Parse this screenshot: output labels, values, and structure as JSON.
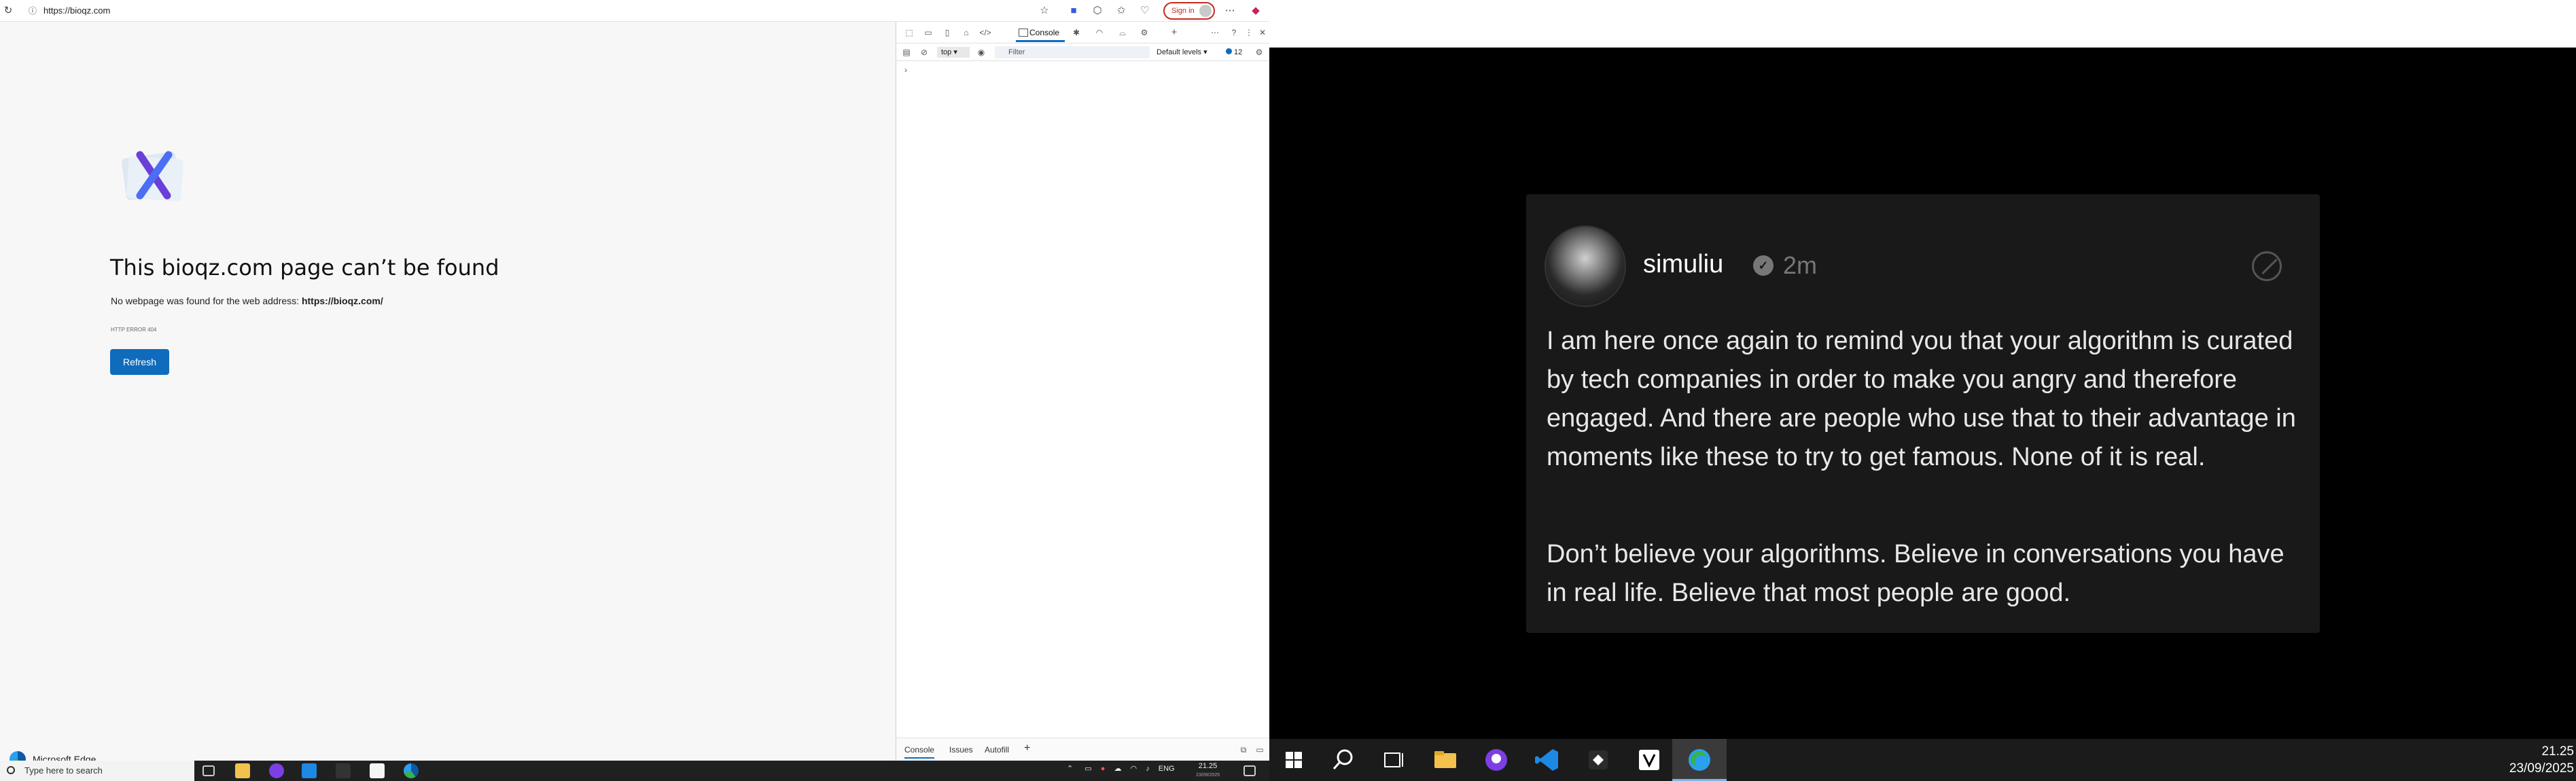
{
  "left_browser": {
    "url": "https://bioqz.com",
    "sign_in_label": "Sign in",
    "error": {
      "title": "This bioqz.com page can’t be found",
      "description": "No webpage was found for the web address:",
      "address": "https://bioqz.com/",
      "code": "HTTP ERROR 404",
      "refresh_label": "Refresh"
    },
    "brand": "Microsoft Edge"
  },
  "devtools": {
    "active_tab": "Console",
    "context": "top",
    "filter_placeholder": "Filter",
    "levels": "Default levels",
    "message_count": "12",
    "prompt": "›",
    "drawer_tabs": [
      "Console",
      "Issues",
      "Autofill"
    ],
    "add_tab": "+"
  },
  "left_taskbar": {
    "search_placeholder": "Type here to search",
    "language": "ENG",
    "time": "21.25",
    "date": "23/09/2025"
  },
  "post": {
    "username": "simuliu",
    "verified": "✓",
    "time_ago": "2m",
    "paragraph1": "I am here once again to remind you that your algorithm is curated by tech companies in order to make you angry and therefore engaged. And there are people who use that to their advantage in moments like these to try to get famous. None of it is real.",
    "paragraph2": "Don’t believe your algorithms. Believe in conversations you have in real life. Believe that most people are good."
  },
  "right_taskbar": {
    "time": "21.25",
    "date": "23/09/2025"
  },
  "colors": {
    "accent": "#0f6cbd",
    "signin": "#c42b1c",
    "post_bg": "#191919"
  }
}
